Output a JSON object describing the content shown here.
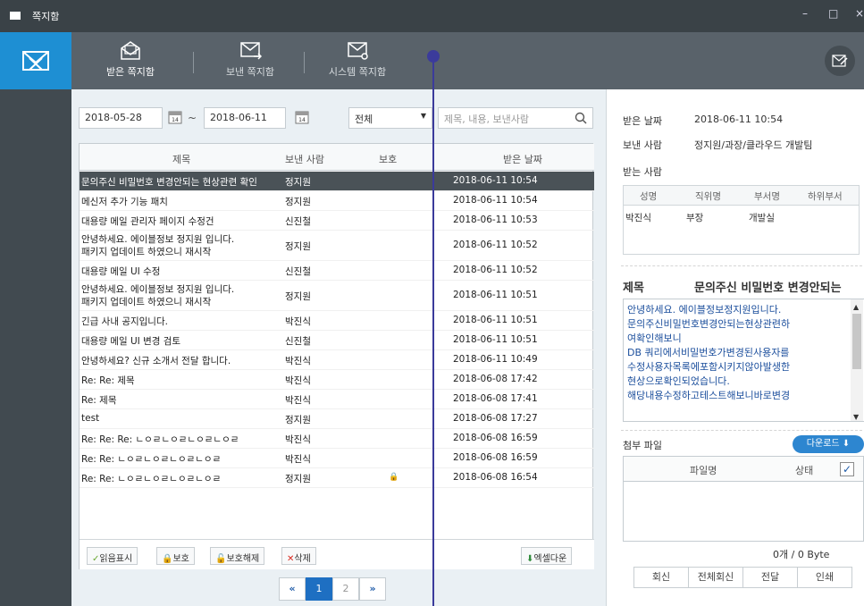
{
  "window": {
    "title": "쪽지함",
    "controls": [
      "–",
      "□",
      "×"
    ]
  },
  "tabs": [
    {
      "label": "받은 쪽지함",
      "active": true
    },
    {
      "label": "보낸 쪽지함",
      "active": false
    },
    {
      "label": "시스템 쪽지함",
      "active": false
    }
  ],
  "filter": {
    "date_from": "2018-05-28",
    "date_sep": "~",
    "date_to": "2018-06-11",
    "category": "전체",
    "search_placeholder": "제목, 내용, 보낸사람"
  },
  "list": {
    "columns": [
      "제목",
      "보낸 사람",
      "보호",
      "받은 날짜"
    ],
    "rows": [
      {
        "title": "문의주신 비밀번호 변경안되는 현상관련 확인",
        "sender": "정지원",
        "protected": false,
        "date": "2018-06-11 10:54",
        "selected": true
      },
      {
        "title": "메신저 추가 기능 패치",
        "sender": "정지원",
        "protected": false,
        "date": "2018-06-11 10:54"
      },
      {
        "title": "대용량 메일 관리자 페이지 수정건",
        "sender": "신진철",
        "protected": false,
        "date": "2018-06-11 10:53"
      },
      {
        "title": "안녕하세요. 에이블정보 정지원 입니다.",
        "title2": "패키지 업데이트 하였으니 재시작",
        "sender": "정지원",
        "protected": false,
        "date": "2018-06-11 10:52"
      },
      {
        "title": "대용량 메일 UI 수정",
        "sender": "신진철",
        "protected": false,
        "date": "2018-06-11 10:52"
      },
      {
        "title": "안녕하세요. 에이블정보 정지원 입니다.",
        "title2": "패키지 업데이트 하였으니 재시작",
        "sender": "정지원",
        "protected": false,
        "date": "2018-06-11 10:51"
      },
      {
        "title": "긴급 사내 공지입니다.",
        "sender": "박진식",
        "protected": false,
        "date": "2018-06-11 10:51"
      },
      {
        "title": "대용량 메일 UI 변경 검토",
        "sender": "신진철",
        "protected": false,
        "date": "2018-06-11 10:51"
      },
      {
        "title": "안녕하세요? 신규 소개서 전달 합니다.",
        "sender": "박진식",
        "protected": false,
        "date": "2018-06-11 10:49"
      },
      {
        "title": "Re: Re: 제목",
        "sender": "박진식",
        "protected": false,
        "date": "2018-06-08 17:42"
      },
      {
        "title": "Re: 제목",
        "sender": "박진식",
        "protected": false,
        "date": "2018-06-08 17:41"
      },
      {
        "title": "test",
        "sender": "정지원",
        "protected": false,
        "date": "2018-06-08 17:27"
      },
      {
        "title": "Re: Re: Re: ㄴㅇㄹㄴㅇㄹㄴㅇㄹㄴㅇㄹ",
        "sender": "박진식",
        "protected": false,
        "date": "2018-06-08 16:59"
      },
      {
        "title": "Re: Re: ㄴㅇㄹㄴㅇㄹㄴㅇㄹㄴㅇㄹ",
        "sender": "박진식",
        "protected": false,
        "date": "2018-06-08 16:59"
      },
      {
        "title": "Re: Re: ㄴㅇㄹㄴㅇㄹㄴㅇㄹㄴㅇㄹ",
        "sender": "정지원",
        "protected": true,
        "date": "2018-06-08 16:54"
      }
    ]
  },
  "actions": {
    "read": "읽음표시",
    "protect": "보호",
    "unprotect": "보호해제",
    "delete": "삭제",
    "excel": "엑셀다운"
  },
  "pager": {
    "first": "«",
    "pages": [
      "1",
      "2"
    ],
    "current": "1",
    "last": "»"
  },
  "detail": {
    "received_label": "받은 날짜",
    "received_value": "2018-06-11 10:54",
    "sender_label": "보낸 사람",
    "sender_value": "정지원/과장/클라우드 개발팀",
    "recipient_label": "받는 사람",
    "recipient_columns": [
      "성명",
      "직위명",
      "부서명",
      "하위부서"
    ],
    "recipient_rows": [
      [
        "박진식",
        "부장",
        "개발실",
        ""
      ]
    ],
    "subject_label": "제목",
    "subject_value": "문의주신 비밀번호 변경안되는",
    "body_lines": [
      "안녕하세요. 에이블정보정지원입니다.",
      "",
      "문의주신비밀번호변경안되는현상관련하",
      "여확인해보니",
      "DB   쿼리에서비밀번호가변경된사용자를",
      "수정사용자목록에포함시키지않아발생한",
      "현상으로확인되었습니다.",
      "해당내용수정하고테스트해보니바로변경"
    ],
    "attach_label": "첨부 파일",
    "download_label": "다운로드",
    "attach_columns": [
      "파일명",
      "상태"
    ],
    "attach_summary": "0개  /  0 Byte",
    "buttons": [
      "회신",
      "전체회신",
      "전달",
      "인쇄"
    ]
  },
  "colors": {
    "accent": "#1e8fd3",
    "dark": "#3a4247",
    "selected_row": "#4a5257",
    "link": "#1b4e9c"
  }
}
